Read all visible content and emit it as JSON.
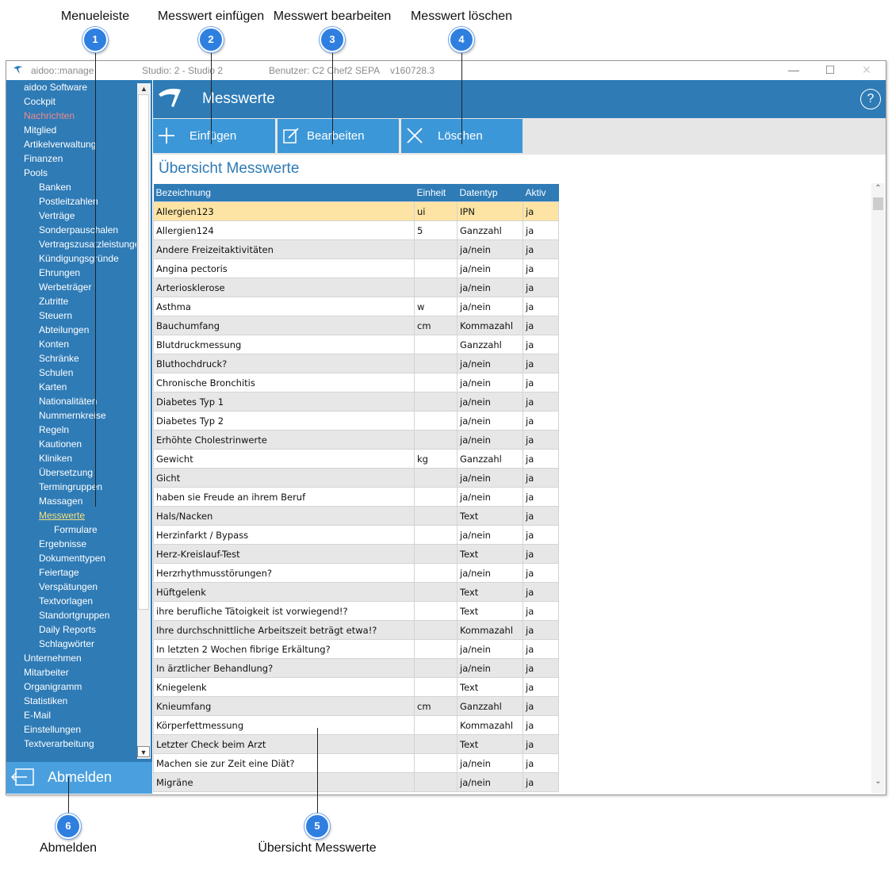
{
  "callouts": [
    {
      "label": "Menueleiste",
      "number": "1"
    },
    {
      "label": "Messwert einfügen",
      "number": "2"
    },
    {
      "label": "Messwert bearbeiten",
      "number": "3"
    },
    {
      "label": "Messwert löschen",
      "number": "4"
    },
    {
      "label": "Übersicht Messwerte",
      "number": "5"
    },
    {
      "label": "Abmelden",
      "number": "6"
    }
  ],
  "titlebar": {
    "app": "aidoo::manage",
    "studio": "Studio: 2 - Studio 2",
    "user": "Benutzer: C2 Chef2",
    "mode": "SEPA",
    "version": "v160728.3",
    "minimize": "—",
    "maximize": "☐",
    "close": "✕"
  },
  "sidebar": {
    "items": [
      {
        "label": "aidoo Software",
        "level": 0
      },
      {
        "label": "Cockpit",
        "level": 0
      },
      {
        "label": "Nachrichten",
        "level": 0,
        "state": "red"
      },
      {
        "label": "Mitglied",
        "level": 0
      },
      {
        "label": "Artikelverwaltung",
        "level": 0
      },
      {
        "label": "Finanzen",
        "level": 0
      },
      {
        "label": "Pools",
        "level": 0
      },
      {
        "label": "Banken",
        "level": 1
      },
      {
        "label": "Postleitzahlen",
        "level": 1
      },
      {
        "label": "Verträge",
        "level": 1
      },
      {
        "label": "Sonderpauschalen",
        "level": 1
      },
      {
        "label": "Vertragszusatzleistungen",
        "level": 1
      },
      {
        "label": "Kündigungsgründe",
        "level": 1
      },
      {
        "label": "Ehrungen",
        "level": 1
      },
      {
        "label": "Werbeträger",
        "level": 1
      },
      {
        "label": "Zutritte",
        "level": 1
      },
      {
        "label": "Steuern",
        "level": 1
      },
      {
        "label": "Abteilungen",
        "level": 1
      },
      {
        "label": "Konten",
        "level": 1
      },
      {
        "label": "Schränke",
        "level": 1
      },
      {
        "label": "Schulen",
        "level": 1
      },
      {
        "label": "Karten",
        "level": 1
      },
      {
        "label": "Nationalitäten",
        "level": 1
      },
      {
        "label": "Nummernkreise",
        "level": 1
      },
      {
        "label": "Regeln",
        "level": 1
      },
      {
        "label": "Kautionen",
        "level": 1
      },
      {
        "label": "Kliniken",
        "level": 1
      },
      {
        "label": "Übersetzung",
        "level": 1
      },
      {
        "label": "Termingruppen",
        "level": 1
      },
      {
        "label": "Massagen",
        "level": 1
      },
      {
        "label": "Messwerte",
        "level": 1,
        "state": "active"
      },
      {
        "label": "Formulare",
        "level": 2
      },
      {
        "label": "Ergebnisse",
        "level": 1
      },
      {
        "label": "Dokumenttypen",
        "level": 1
      },
      {
        "label": "Feiertage",
        "level": 1
      },
      {
        "label": "Verspätungen",
        "level": 1
      },
      {
        "label": "Textvorlagen",
        "level": 1
      },
      {
        "label": "Standortgruppen",
        "level": 1
      },
      {
        "label": "Daily Reports",
        "level": 1
      },
      {
        "label": "Schlagwörter",
        "level": 1
      },
      {
        "label": "Unternehmen",
        "level": 0
      },
      {
        "label": "Mitarbeiter",
        "level": 0
      },
      {
        "label": "Organigramm",
        "level": 0
      },
      {
        "label": "Statistiken",
        "level": 0
      },
      {
        "label": "E-Mail",
        "level": 0
      },
      {
        "label": "Einstellungen",
        "level": 0
      },
      {
        "label": "Textverarbeitung",
        "level": 0
      }
    ],
    "scroll_up": "▲",
    "scroll_down": "▼",
    "logout_label": "Abmelden"
  },
  "header": {
    "title": "Messwerte",
    "help": "?"
  },
  "toolbar": {
    "insert_label": "Einfügen",
    "edit_label": "Bearbeiten",
    "delete_label": "Löschen"
  },
  "content": {
    "title": "Übersicht Messwerte",
    "columns": [
      "Bezeichnung",
      "Einheit",
      "Datentyp",
      "Aktiv"
    ],
    "rows": [
      [
        "Allergien123",
        "ui",
        "IPN",
        "ja"
      ],
      [
        "Allergien124",
        "5",
        "Ganzzahl",
        "ja"
      ],
      [
        "Andere Freizeitaktivitäten",
        "",
        "ja/nein",
        "ja"
      ],
      [
        "Angina pectoris",
        "",
        "ja/nein",
        "ja"
      ],
      [
        "Arteriosklerose",
        "",
        "ja/nein",
        "ja"
      ],
      [
        "Asthma",
        "w",
        "ja/nein",
        "ja"
      ],
      [
        "Bauchumfang",
        "cm",
        "Kommazahl",
        "ja"
      ],
      [
        "Blutdruckmessung",
        "",
        "Ganzzahl",
        "ja"
      ],
      [
        "Bluthochdruck?",
        "",
        "ja/nein",
        "ja"
      ],
      [
        "Chronische Bronchitis",
        "",
        "ja/nein",
        "ja"
      ],
      [
        "Diabetes Typ 1",
        "",
        "ja/nein",
        "ja"
      ],
      [
        "Diabetes Typ 2",
        "",
        "ja/nein",
        "ja"
      ],
      [
        "Erhöhte Cholestrinwerte",
        "",
        "ja/nein",
        "ja"
      ],
      [
        "Gewicht",
        "kg",
        "Ganzzahl",
        "ja"
      ],
      [
        "Gicht",
        "",
        "ja/nein",
        "ja"
      ],
      [
        "haben sie Freude an ihrem Beruf",
        "",
        "ja/nein",
        "ja"
      ],
      [
        "Hals/Nacken",
        "",
        "Text",
        "ja"
      ],
      [
        "Herzinfarkt / Bypass",
        "",
        "ja/nein",
        "ja"
      ],
      [
        "Herz-Kreislauf-Test",
        "",
        "Text",
        "ja"
      ],
      [
        "Herzrhythmusstörungen?",
        "",
        "ja/nein",
        "ja"
      ],
      [
        "Hüftgelenk",
        "",
        "Text",
        "ja"
      ],
      [
        "ihre berufliche Tätoigkeit ist vorwiegend!?",
        "",
        "Text",
        "ja"
      ],
      [
        "Ihre durchschnittliche Arbeitszeit beträgt etwa!?",
        "",
        "Kommazahl",
        "ja"
      ],
      [
        "In letzten 2 Wochen fibrige Erkältung?",
        "",
        "ja/nein",
        "ja"
      ],
      [
        "In ärztlicher Behandlung?",
        "",
        "ja/nein",
        "ja"
      ],
      [
        "Kniegelenk",
        "",
        "Text",
        "ja"
      ],
      [
        "Knieumfang",
        "cm",
        "Ganzzahl",
        "ja"
      ],
      [
        "Körperfettmessung",
        "",
        "Kommazahl",
        "ja"
      ],
      [
        "Letzter Check beim Arzt",
        "",
        "Text",
        "ja"
      ],
      [
        "Machen sie zur Zeit eine Diät?",
        "",
        "ja/nein",
        "ja"
      ],
      [
        "Migräne",
        "",
        "ja/nein",
        "ja"
      ]
    ],
    "scroll_up": "⌃",
    "scroll_down": "⌄"
  }
}
